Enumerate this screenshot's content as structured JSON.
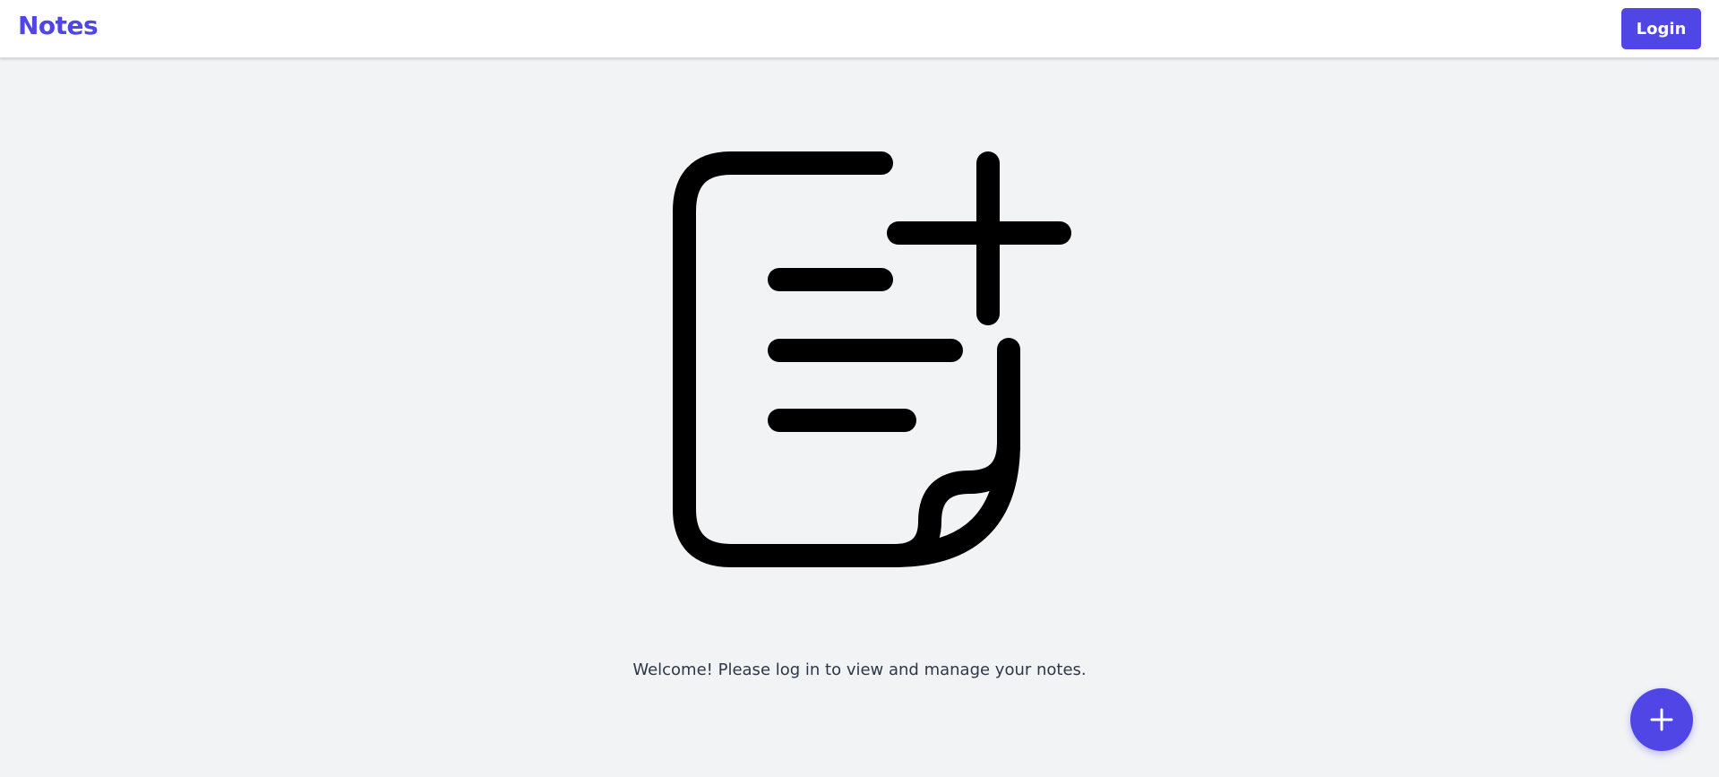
{
  "header": {
    "brand": "Notes",
    "login_label": "Login"
  },
  "main": {
    "illustration_icon": "note-add-icon",
    "welcome_text": "Welcome! Please log in to view and manage your notes."
  },
  "fab": {
    "icon": "plus-icon"
  },
  "colors": {
    "accent": "#4f46e5",
    "background": "#f2f3f5",
    "header_bg": "#ffffff",
    "text": "#2d3748"
  }
}
